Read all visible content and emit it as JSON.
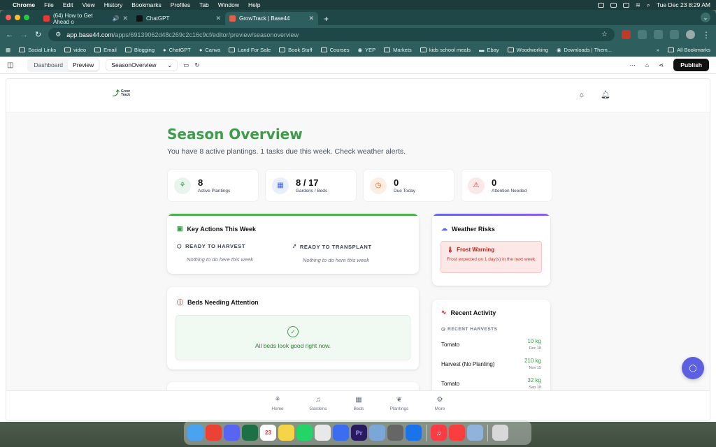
{
  "menubar": {
    "items": [
      "Chrome",
      "File",
      "Edit",
      "View",
      "History",
      "Bookmarks",
      "Profiles",
      "Tab",
      "Window",
      "Help"
    ],
    "clock": "Tue Dec 23  8:29 AM"
  },
  "browser": {
    "tabs": [
      {
        "title": "(64) How to Get Ahead o",
        "favicon_color": "#e53935"
      },
      {
        "title": "ChatGPT",
        "favicon_color": "#111111"
      },
      {
        "title": "GrowTrack | Base44",
        "favicon_color": "#e0604a"
      }
    ],
    "url_host": "app.base44.com",
    "url_path": "/apps/69139062d48c269c2c16c9cf/editor/preview/seasonoverview",
    "bookmarks": [
      "Social Links",
      "video",
      "Email",
      "Blogging",
      "ChatGPT",
      "Canva",
      "Land For Sale",
      "Book Stuff",
      "Courses",
      "YEP",
      "Markets",
      "kids school meals",
      "Ebay",
      "Woodworking",
      "Downloads | Them..."
    ],
    "all_bookmarks": "All Bookmarks"
  },
  "editor": {
    "dashboard_tab": "Dashboard",
    "preview_tab": "Preview",
    "page_select": "SeasonOverview",
    "publish": "Publish"
  },
  "app": {
    "logo_line1": "Grow",
    "logo_line2": "Track",
    "title": "Season Overview",
    "subtitle": "You have 8 active plantings. 1 tasks due this week. Check weather alerts.",
    "stats": [
      {
        "value": "8",
        "label": "Active Plantings",
        "icon": "sprout-icon",
        "bg": "#e8f5ea",
        "color": "#3f9a4c"
      },
      {
        "value": "8 / 17",
        "label": "Gardens / Beds",
        "icon": "grid-icon",
        "bg": "#e8efff",
        "color": "#3b5bdb"
      },
      {
        "value": "0",
        "label": "Due Today",
        "icon": "clock-check-icon",
        "bg": "#fdeee4",
        "color": "#e8590c"
      },
      {
        "value": "0",
        "label": "Attention Needed",
        "icon": "alert-triangle-icon",
        "bg": "#fde8e8",
        "color": "#dc2626"
      }
    ],
    "key_actions": {
      "title": "Key Actions This Week",
      "col1_title": "READY TO HARVEST",
      "col1_empty": "Nothing to do here this week",
      "col2_title": "READY TO TRANSPLANT",
      "col2_empty": "Nothing to do here this week"
    },
    "beds_attention": {
      "title": "Beds Needing Attention",
      "message": "All beds look good right now."
    },
    "weather": {
      "title": "Weather Risks",
      "alert_title": "Frost Warning",
      "alert_text": "Frost expected on 1 day(s) in the next week."
    },
    "recent_activity": {
      "title": "Recent Activity",
      "subtitle": "RECENT HARVESTS",
      "rows": [
        {
          "name": "Tomato",
          "qty": "10 kg",
          "date": "Dec 18"
        },
        {
          "name": "Harvest (No Planting)",
          "qty": "210 kg",
          "date": "Nov 15"
        },
        {
          "name": "Tomato",
          "qty": "32 kg",
          "date": "Sep 18"
        }
      ]
    },
    "nav": [
      "Home",
      "Gardens",
      "Beds",
      "Plantings",
      "More"
    ],
    "colors": {
      "primary_green": "#3f9a4c",
      "accent_indigo": "#5b5fe0"
    }
  }
}
